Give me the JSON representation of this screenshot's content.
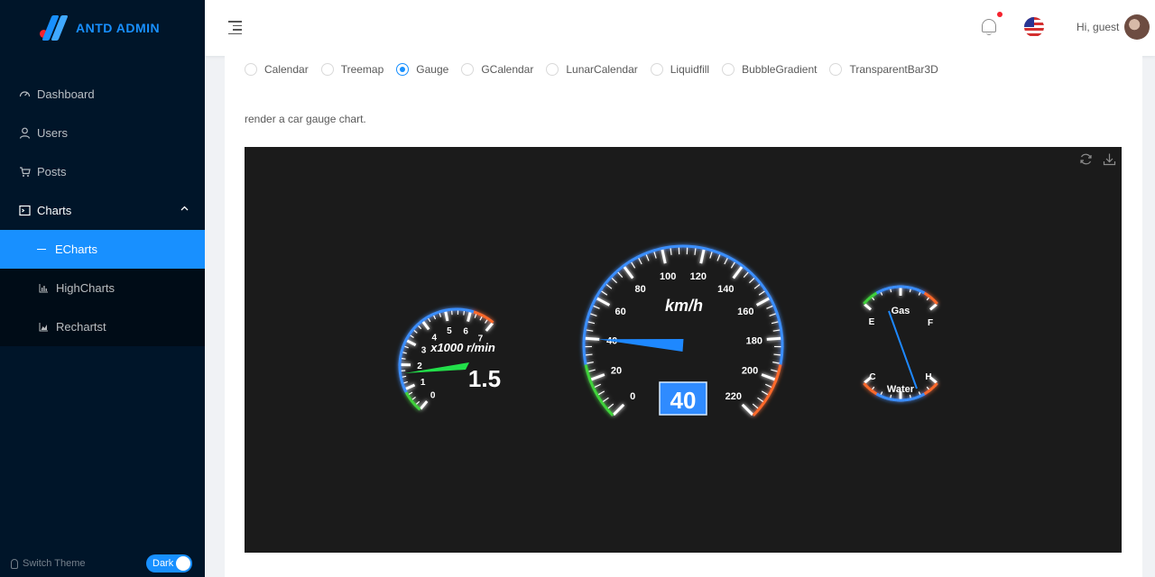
{
  "brand": {
    "title": "ANTD ADMIN"
  },
  "sidebar": {
    "items": [
      {
        "label": "Dashboard",
        "icon": "dashboard-icon"
      },
      {
        "label": "Users",
        "icon": "user-icon"
      },
      {
        "label": "Posts",
        "icon": "shopping-cart-icon"
      },
      {
        "label": "Charts",
        "icon": "code-icon"
      }
    ],
    "submenu": [
      {
        "label": "ECharts",
        "active": true
      },
      {
        "label": "HighCharts",
        "icon": "bar-chart-icon"
      },
      {
        "label": "Rechartst",
        "icon": "area-chart-icon"
      }
    ],
    "footer": {
      "switch_label": "Switch Theme",
      "toggle_label": "Dark"
    }
  },
  "header": {
    "greeting": "Hi,",
    "username": "guest"
  },
  "content": {
    "radio_options": [
      "Calendar",
      "Treemap",
      "Gauge",
      "GCalendar",
      "LunarCalendar",
      "Liquidfill",
      "BubbleGradient",
      "TransparentBar3D"
    ],
    "selected_option": "Gauge",
    "description": "render a car gauge chart."
  },
  "colors": {
    "accent": "#1890ff",
    "sider_bg": "#001529",
    "chart_bg": "#1b1b1b"
  },
  "chart_data": {
    "type": "gauge",
    "gauges": [
      {
        "name": "rpm",
        "unit": "x1000 r/min",
        "min": 0,
        "max": 7,
        "value": 1.5,
        "value_label": "1.5",
        "ticks": [
          "0",
          "1",
          "2",
          "3",
          "4",
          "5",
          "6",
          "7"
        ]
      },
      {
        "name": "speed",
        "unit": "km/h",
        "min": 0,
        "max": 220,
        "value": 40,
        "value_label": "40",
        "ticks": [
          "0",
          "20",
          "40",
          "60",
          "80",
          "100",
          "120",
          "140",
          "160",
          "180",
          "200",
          "220"
        ]
      },
      {
        "name": "gas",
        "label": "Gas",
        "min_label": "E",
        "max_label": "F",
        "value": 0.2
      },
      {
        "name": "water",
        "label": "Water",
        "min_label": "C",
        "max_label": "H",
        "value": 0.5
      }
    ]
  }
}
